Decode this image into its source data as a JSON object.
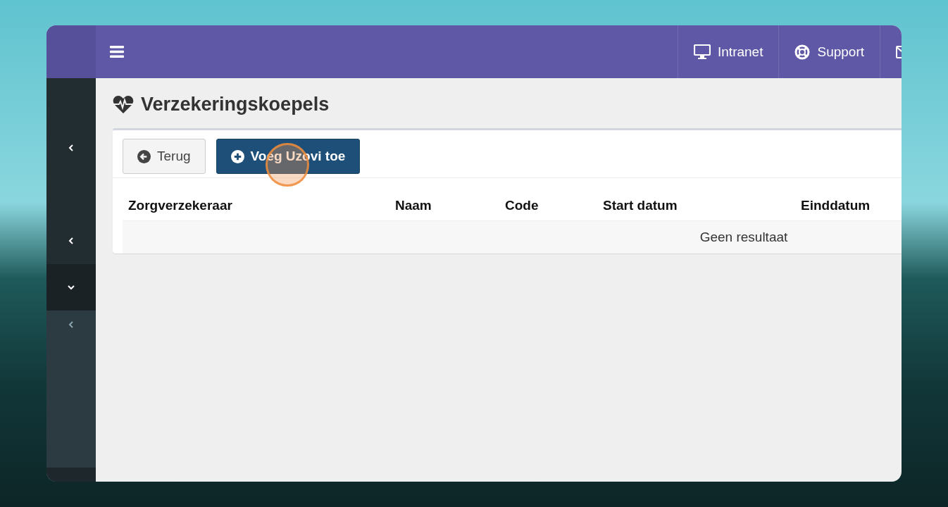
{
  "topbar": {
    "nav_links": [
      {
        "kind": "monitor",
        "label": "Intranet"
      },
      {
        "kind": "lifebuoy",
        "label": "Support"
      },
      {
        "kind": "envelope"
      }
    ]
  },
  "sidebar": {
    "items": [
      {
        "expanded": false
      },
      {
        "expanded": false
      },
      {
        "expanded": true,
        "children": [
          {
            "expanded": false
          }
        ]
      }
    ]
  },
  "page": {
    "title": "Verzekeringskoepels"
  },
  "toolbar": {
    "buttons": [
      {
        "kind": "back",
        "label": "Terug"
      },
      {
        "kind": "add",
        "label": "Voeg Uzovi toe"
      }
    ]
  },
  "table": {
    "columns": [
      "Zorgverzekeraar",
      "Naam",
      "Code",
      "Start datum",
      "Einddatum"
    ],
    "empty_message": "Geen resultaat"
  }
}
